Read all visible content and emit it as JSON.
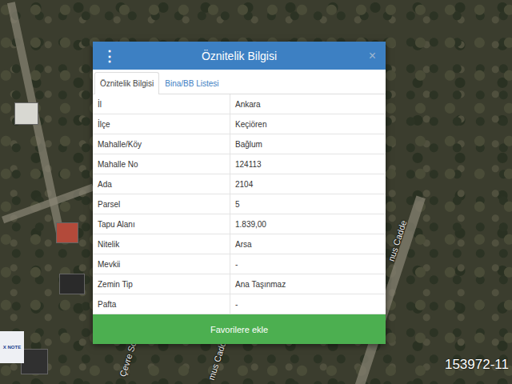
{
  "map": {
    "labels": [
      {
        "text": "Çevre Sok"
      },
      {
        "text": "mus Cadd"
      },
      {
        "text": "nus Cadde"
      }
    ],
    "watermark": "153972-11",
    "logo": "X NOTE"
  },
  "dialog": {
    "title": "Öznitelik Bilgisi",
    "menu_icon": "⋮",
    "close_icon": "×",
    "tabs": [
      {
        "label": "Öznitelik Bilgisi",
        "selected": true
      },
      {
        "label": "Bina/BB Listesi",
        "selected": false
      }
    ],
    "rows": [
      {
        "label": "İl",
        "value": "Ankara"
      },
      {
        "label": "İlçe",
        "value": "Keçiören"
      },
      {
        "label": "Mahalle/Köy",
        "value": "Bağlum"
      },
      {
        "label": "Mahalle No",
        "value": "124113"
      },
      {
        "label": "Ada",
        "value": "2104"
      },
      {
        "label": "Parsel",
        "value": "5"
      },
      {
        "label": "Tapu Alanı",
        "value": "1.839,00"
      },
      {
        "label": "Nitelik",
        "value": "Arsa"
      },
      {
        "label": "Mevkii",
        "value": "-"
      },
      {
        "label": "Zemin Tip",
        "value": "Ana Taşınmaz"
      },
      {
        "label": "Pafta",
        "value": "-"
      }
    ],
    "button": "Favorilere ekle"
  }
}
